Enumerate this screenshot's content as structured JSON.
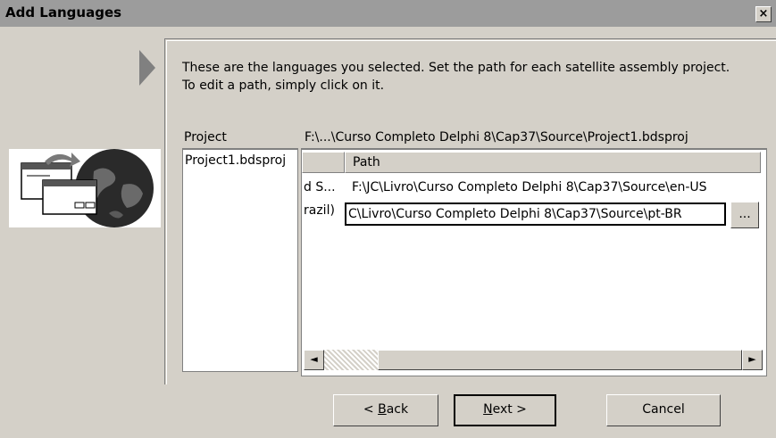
{
  "window": {
    "title": "Add Languages",
    "close_glyph": "×"
  },
  "intro": {
    "text": "These are the languages you selected. Set the path for each satellite assembly project. To edit a path, simply click on it."
  },
  "projects": {
    "header": "Project",
    "items": [
      "Project1.bdsproj"
    ]
  },
  "grid": {
    "project_path": "F:\\...\\Curso Completo Delphi 8\\Cap37\\Source\\Project1.bdsproj",
    "column_header": "Path",
    "rows": [
      {
        "language": "d S...",
        "path": "F:\\JC\\Livro\\Curso Completo Delphi 8\\Cap37\\Source\\en-US"
      },
      {
        "language": "razil)",
        "path": "C\\Livro\\Curso Completo Delphi 8\\Cap37\\Source\\pt-BR"
      }
    ],
    "ellipsis_label": "..."
  },
  "scrollbar": {
    "left_arrow": "◄",
    "right_arrow": "►"
  },
  "buttons": {
    "back": {
      "prefix": "< ",
      "mnemonic": "B",
      "rest": "ack"
    },
    "next": {
      "mnemonic": "N",
      "rest": "ext >"
    },
    "cancel": "Cancel"
  },
  "icons": [
    "forward-arrow-icon",
    "add-language-globe-icon",
    "close-icon"
  ]
}
